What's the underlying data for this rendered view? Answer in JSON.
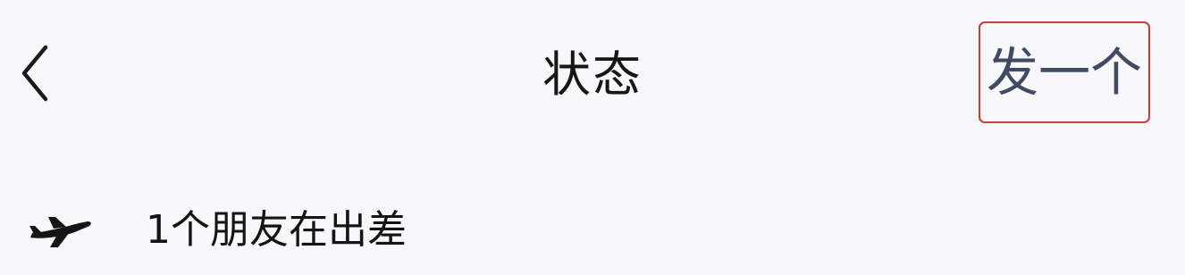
{
  "nav": {
    "back_icon": "chevron-left-icon",
    "title": "状态",
    "post_button_label": "发一个",
    "post_button_highlight_color": "#cf3a3a"
  },
  "status_list": {
    "items": [
      {
        "icon": "airplane-icon",
        "label": "1个朋友在出差"
      }
    ]
  }
}
